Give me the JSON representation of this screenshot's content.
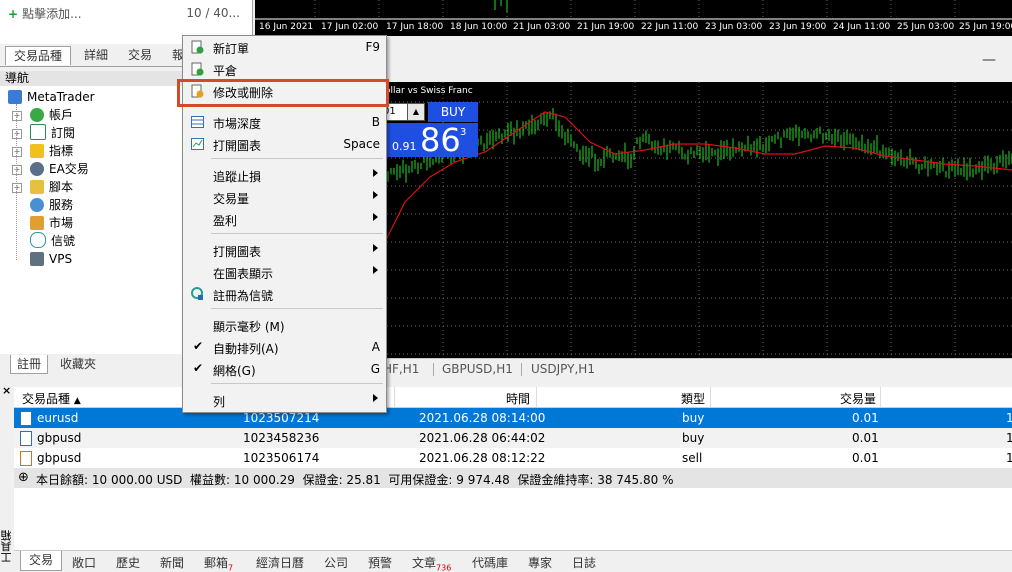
{
  "market_watch": {
    "add_label": "點擊添加...",
    "count": "10 / 40...",
    "tabs": [
      "交易品種",
      "詳細",
      "交易",
      "報"
    ]
  },
  "navigator": {
    "title": "導航",
    "root": "MetaTrader",
    "items": [
      "帳戶",
      "訂閱",
      "指標",
      "EA交易",
      "腳本",
      "服務",
      "市場",
      "信號",
      "VPS"
    ],
    "tabs": [
      "註冊",
      "收藏夾"
    ]
  },
  "chart": {
    "time_ticks": [
      "16 Jun 2021",
      "17 Jun 02:00",
      "17 Jun 18:00",
      "18 Jun 10:00",
      "21 Jun 03:00",
      "21 Jun 19:00",
      "22 Jun 11:00",
      "23 Jun 03:00",
      "23 Jun 19:00",
      "24 Jun 11:00",
      "25 Jun 03:00",
      "25 Jun 19:00"
    ],
    "symbol_title": "ollar vs Swiss Franc",
    "lot_value": "01",
    "buy_label": "BUY",
    "buy_price_small": "0.91",
    "buy_price_big": "86",
    "buy_price_sup": "3",
    "minimize_label": "—",
    "tabs": [
      "HF,H1",
      "GBPUSD,H1",
      "USDJPY,H1"
    ],
    "colors": {
      "background": "#000000",
      "candles": "#22dd22",
      "ma": "#dd1111",
      "grid": "#6a6a6a"
    }
  },
  "context_menu": {
    "items": [
      {
        "label": "新訂單",
        "shortcut": "F9",
        "icon": "new-order-icon"
      },
      {
        "label": "平倉",
        "shortcut": "",
        "icon": "close-position-icon"
      },
      {
        "label": "修改或刪除",
        "shortcut": "",
        "icon": "modify-order-icon"
      },
      {
        "label": "市場深度",
        "shortcut": "B",
        "icon": "market-depth-icon"
      },
      {
        "label": "打開圖表",
        "shortcut": "Space",
        "icon": "open-chart-icon"
      },
      {
        "label": "追蹤止損",
        "shortcut": "",
        "submenu": true
      },
      {
        "label": "交易量",
        "shortcut": "",
        "submenu": true
      },
      {
        "label": "盈利",
        "shortcut": "",
        "submenu": true
      },
      {
        "label": "打開圖表",
        "shortcut": "",
        "submenu": true
      },
      {
        "label": "在圖表顯示",
        "shortcut": "",
        "submenu": true
      },
      {
        "label": "註冊為信號",
        "shortcut": "",
        "icon": "signal-icon"
      },
      {
        "label": "顯示毫秒 (M)",
        "shortcut": ""
      },
      {
        "label": "自動排列(A)",
        "shortcut": "A",
        "checked": true
      },
      {
        "label": "網格(G)",
        "shortcut": "G",
        "checked": true
      },
      {
        "label": "列",
        "shortcut": "",
        "submenu": true
      }
    ]
  },
  "terminal": {
    "close_label": "×",
    "columns": [
      "交易品種",
      "時間",
      "類型",
      "交易量"
    ],
    "rows": [
      {
        "symbol": "eurusd",
        "ticket": "1023507214",
        "time": "2021.06.28 08:14:00",
        "type": "buy",
        "volume": "0.01",
        "extra": "1"
      },
      {
        "symbol": "gbpusd",
        "ticket": "1023458236",
        "time": "2021.06.28 06:44:02",
        "type": "buy",
        "volume": "0.01",
        "extra": "1"
      },
      {
        "symbol": "gbpusd",
        "ticket": "1023506174",
        "time": "2021.06.28 08:12:22",
        "type": "sell",
        "volume": "0.01",
        "extra": "1"
      }
    ],
    "summary": "本日餘額: 10 000.00 USD  權益數: 10 000.29  保證金: 25.81  可用保證金: 9 974.48  保證金維持率: 38 745.80 %",
    "side_label": "工具箱",
    "tabs": [
      {
        "label": "交易"
      },
      {
        "label": "敞口"
      },
      {
        "label": "歷史"
      },
      {
        "label": "新聞"
      },
      {
        "label": "郵箱",
        "badge": "7"
      },
      {
        "label": "經濟日曆"
      },
      {
        "label": "公司"
      },
      {
        "label": "預警"
      },
      {
        "label": "文章",
        "badge": "736"
      },
      {
        "label": "代碼庫"
      },
      {
        "label": "專家"
      },
      {
        "label": "日誌"
      }
    ]
  }
}
